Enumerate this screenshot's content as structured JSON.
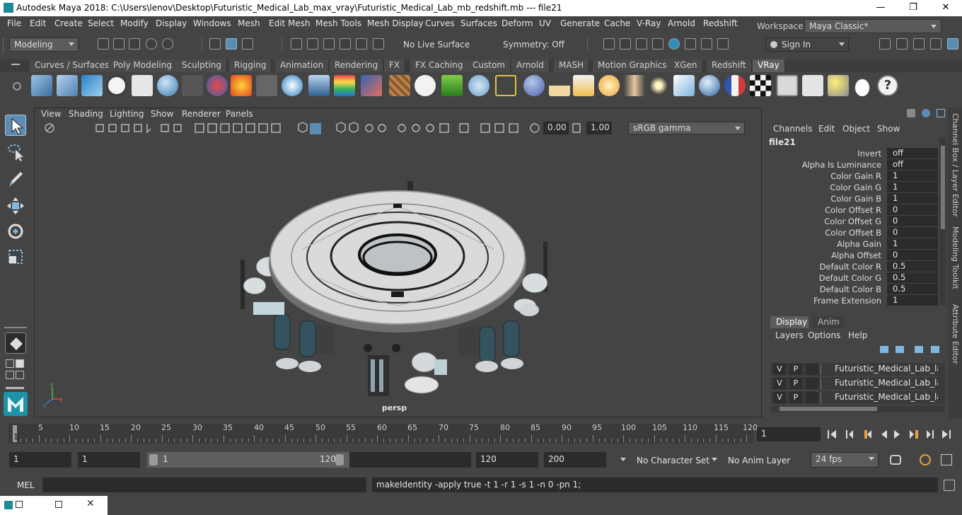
{
  "window": {
    "title": "Autodesk Maya 2018: C:\\Users\\lenov\\Desktop\\Futuristic_Medical_Lab_max_vray\\Futuristic_Medical_Lab_mb_redshift.mb   ---   file21",
    "minimize": "—",
    "maximize": "❐",
    "close": "✕"
  },
  "menu": {
    "items": [
      "File",
      "Edit",
      "Create",
      "Select",
      "Modify",
      "Display",
      "Windows",
      "Mesh",
      "Edit Mesh",
      "Mesh Tools",
      "Mesh Display",
      "Curves",
      "Surfaces",
      "Deform",
      "UV",
      "Generate",
      "Cache",
      "V-Ray",
      "Arnold",
      "Redshift"
    ],
    "workspace_label": "Workspace :",
    "workspace_value": "Maya Classic*"
  },
  "status": {
    "mode": "Modeling",
    "live_surface": "No Live Surface",
    "symmetry": "Symmetry: Off",
    "sign_in": "Sign In"
  },
  "shelf": {
    "tabs": [
      "Curves / Surfaces",
      "Poly Modeling",
      "Sculpting",
      "Rigging",
      "Animation",
      "Rendering",
      "FX",
      "FX Caching",
      "Custom",
      "Arnold",
      "MASH",
      "Motion Graphics",
      "XGen",
      "Redshift",
      "VRay"
    ],
    "active_tab": "VRay"
  },
  "viewport": {
    "menu": [
      "View",
      "Shading",
      "Lighting",
      "Show",
      "Renderer",
      "Panels"
    ],
    "exposure": "0.00",
    "gamma": "1.00",
    "color_space": "sRGB gamma",
    "camera_label": "persp"
  },
  "channel_box": {
    "menu": [
      "Channels",
      "Edit",
      "Object",
      "Show"
    ],
    "node": "file21",
    "attributes": [
      {
        "name": "Invert",
        "value": "off"
      },
      {
        "name": "Alpha Is Luminance",
        "value": "off"
      },
      {
        "name": "Color Gain R",
        "value": "1"
      },
      {
        "name": "Color Gain G",
        "value": "1"
      },
      {
        "name": "Color Gain B",
        "value": "1"
      },
      {
        "name": "Color Offset R",
        "value": "0"
      },
      {
        "name": "Color Offset G",
        "value": "0"
      },
      {
        "name": "Color Offset B",
        "value": "0"
      },
      {
        "name": "Alpha Gain",
        "value": "1"
      },
      {
        "name": "Alpha Offset",
        "value": "0"
      },
      {
        "name": "Default Color R",
        "value": "0.5"
      },
      {
        "name": "Default Color G",
        "value": "0.5"
      },
      {
        "name": "Default Color B",
        "value": "0.5"
      },
      {
        "name": "Frame Extension",
        "value": "1"
      }
    ]
  },
  "side_tabs": [
    "Channel Box / Layer Editor",
    "Modeling Toolkit",
    "Attribute Editor"
  ],
  "layer_editor": {
    "tabs": [
      "Display",
      "Anim"
    ],
    "menu": [
      "Layers",
      "Options",
      "Help"
    ],
    "v": "V",
    "p": "P",
    "layers": [
      "Futuristic_Medical_Lab_layer",
      "Futuristic_Medical_Lab_layer",
      "Futuristic_Medical_Lab_layer"
    ]
  },
  "timeline": {
    "labels": [
      "5",
      "10",
      "15",
      "20",
      "25",
      "30",
      "35",
      "40",
      "45",
      "50",
      "55",
      "60",
      "65",
      "70",
      "75",
      "80",
      "85",
      "90",
      "95",
      "100",
      "105",
      "110",
      "115",
      "120"
    ],
    "start_marker": "1",
    "current_frame": "1"
  },
  "range": {
    "start": "1",
    "playback_start": "1",
    "slider_start": "1",
    "slider_end": "120",
    "playback_end": "120",
    "end": "200",
    "character_set": "No Character Set",
    "anim_layer": "No Anim Layer",
    "fps": "24 fps"
  },
  "command": {
    "language": "MEL",
    "result": "makeIdentity -apply true -t 1 -r 1 -s 1 -n 0 -pn 1;"
  }
}
